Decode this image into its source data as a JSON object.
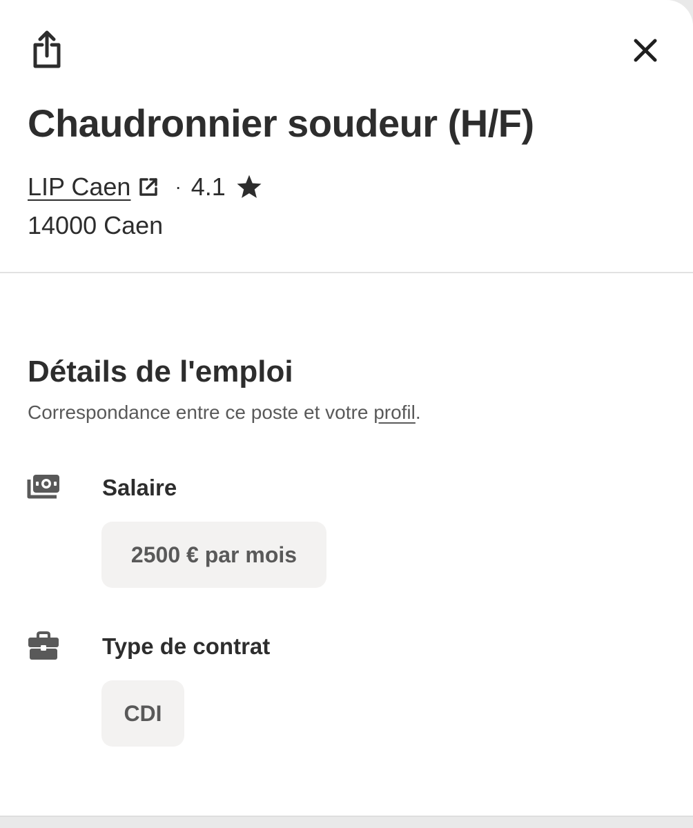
{
  "header": {
    "share_icon": "share-icon",
    "close_icon": "close-icon"
  },
  "job": {
    "title": "Chaudronnier soudeur (H/F)",
    "company": "LIP Caen",
    "external_link_icon": "external-link-icon",
    "separator": "·",
    "rating": "4.1",
    "rating_icon": "star-icon",
    "location": "14000 Caen"
  },
  "details": {
    "title": "Détails de l'emploi",
    "subtitle_prefix": "Correspondance entre ce poste et votre ",
    "subtitle_link": "profil",
    "subtitle_suffix": ".",
    "salary": {
      "icon": "money-icon",
      "label": "Salaire",
      "value": "2500 € par mois"
    },
    "contract": {
      "icon": "briefcase-icon",
      "label": "Type de contrat",
      "value": "CDI"
    }
  },
  "colors": {
    "text": "#2d2d2d",
    "muted": "#595959",
    "chip_bg": "#f3f2f1",
    "divider": "#e2e2e2"
  }
}
